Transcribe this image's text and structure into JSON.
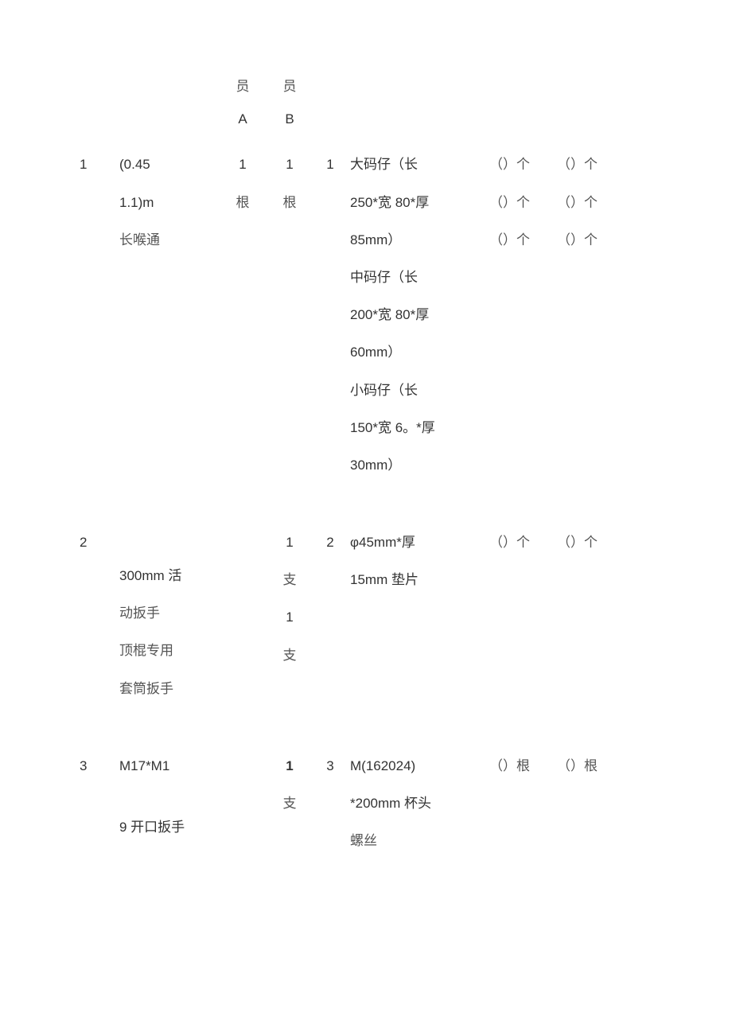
{
  "header": {
    "colA_line1": "员",
    "colA_line2": "A",
    "colB_line1": "员",
    "colB_line2": "B"
  },
  "rows": [
    {
      "num": "1",
      "name_line1": "(0.45",
      "name_line2": "1.1)m",
      "name_line3": "长喉通",
      "a_line1": "1",
      "a_line2": "根",
      "b_line1": "1",
      "b_line2": "根",
      "idx": "1",
      "desc_line1": "大码仔（长",
      "desc_line2": "250*宽 80*厚",
      "desc_line3": "85mm）",
      "desc_line4": "中码仔（长",
      "desc_line5": "200*宽 80*厚",
      "desc_line6": "60mm）",
      "desc_line7": "小码仔（长",
      "desc_line8": "150*宽 6。*厚",
      "desc_line9": "30mm）",
      "qty1_line1": "（）个",
      "qty1_line2": "（）个",
      "qty1_line3": "（）个",
      "qty2_line1": "（）个",
      "qty2_line2": "（）个",
      "qty2_line3": "（）个"
    },
    {
      "num": "2",
      "name_line1": "",
      "name_line2": "300mm 活",
      "name_line3": "动扳手",
      "name_line4": "顶棍专用",
      "name_line5": "套筒扳手",
      "a_line1": "",
      "b_line1": "1",
      "b_line2": "支",
      "b_line3": "1",
      "b_line4": "支",
      "idx": "2",
      "desc_line1": "φ45mm*厚",
      "desc_line2": "15mm 垫片",
      "qty1_line1": "（）个",
      "qty2_line1": "（）个"
    },
    {
      "num": "3",
      "name_line1": "M17*M1",
      "name_line2": "",
      "name_line3": "9 开口扳手",
      "b_line1": "1",
      "b_line2": "支",
      "idx": "3",
      "desc_line1": "M(162024)",
      "desc_line2": "*200mm 杯头",
      "desc_line3": "螺丝",
      "qty1_line1": "（）根",
      "qty2_line1": "（）根"
    }
  ]
}
